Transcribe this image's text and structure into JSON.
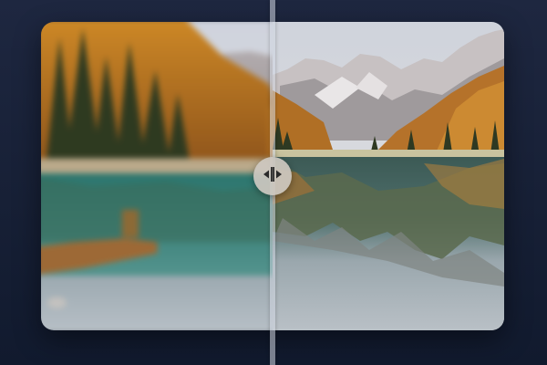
{
  "app": {
    "view": "before-after-image-comparison"
  },
  "comparison": {
    "left_variant": "blurred",
    "right_variant": "sharp",
    "split_fraction": 0.5
  },
  "handle": {
    "icon": "split-arrows-icon",
    "color": "#cdc8c0"
  },
  "colors": {
    "background_top": "#1e2740",
    "background_bottom": "#111a2e",
    "divider": "#d2d7e1"
  }
}
